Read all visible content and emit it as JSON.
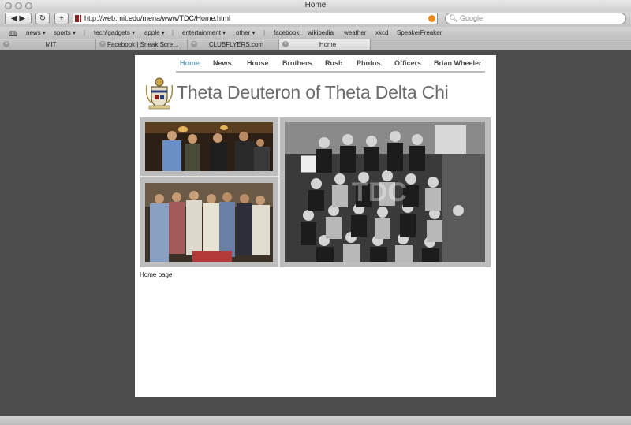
{
  "window": {
    "title": "Home"
  },
  "toolbar": {
    "back_label": "◀ ▶",
    "reload_label": "↻",
    "add_label": "+",
    "url": "http://web.mit.edu/mena/www/TDC/Home.html",
    "search_placeholder": "Google"
  },
  "bookmarks": [
    "news ▾",
    "sports ▾",
    "tech/gadgets ▾",
    "apple ▾",
    "entertainment ▾",
    "other ▾",
    "facebook",
    "wikipedia",
    "weather",
    "xkcd",
    "SpeakerFreaker"
  ],
  "tabs": [
    {
      "label": "MIT"
    },
    {
      "label": "Facebook | Sneak Screen..."
    },
    {
      "label": "CLUBFLYERS.com"
    },
    {
      "label": "Home"
    }
  ],
  "page": {
    "nav": [
      "Home",
      "News",
      "House",
      "Brothers",
      "Rush",
      "Photos",
      "Officers",
      "Brian Wheeler"
    ],
    "active_nav": "Home",
    "title": "Theta Deuteron of Theta Delta Chi",
    "caption": "Home page"
  },
  "colors": {
    "accent": "#6fa7c3",
    "background": "#4d4d4d"
  }
}
